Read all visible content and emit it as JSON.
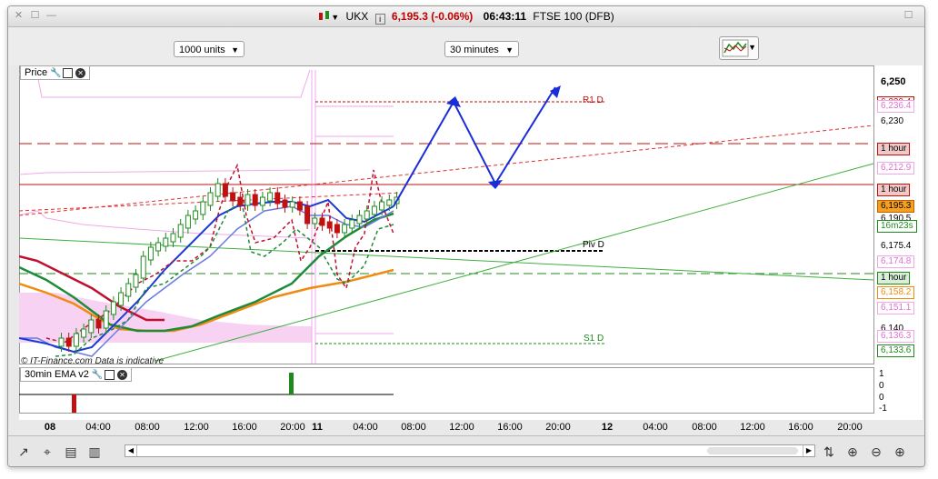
{
  "window": {
    "symbol": "UKX",
    "price": "6,195.3 (-0.06%)",
    "time": "06:43:11",
    "instrument": "FTSE 100 (DFB)"
  },
  "toolbar": {
    "units": "1000 units",
    "interval": "30 minutes"
  },
  "panels": {
    "price": "Price",
    "ema": "30min EMA v2"
  },
  "watermark": "© IT-Finance.com  Data is indicative",
  "pivots": {
    "r1": "R1 D",
    "piv": "Piv D",
    "s1": "S1 D"
  },
  "axis": {
    "top_label": "6,250",
    "price_labels": [
      {
        "text": "6,239.4",
        "kind": "red"
      },
      {
        "text": "6,236.4",
        "kind": "pink"
      },
      {
        "text": "6,230",
        "kind": "plain"
      },
      {
        "text": "1 hour",
        "kind": "hour"
      },
      {
        "text": "6,212.9",
        "kind": "pink"
      },
      {
        "text": "1 hour",
        "kind": "hour"
      },
      {
        "text": "6,195.3",
        "kind": "current"
      },
      {
        "text": "6,190.5",
        "kind": "plain"
      },
      {
        "text": "16m23s",
        "kind": "green"
      },
      {
        "text": "6,175.4",
        "kind": "plain"
      },
      {
        "text": "6,174.8",
        "kind": "pink"
      },
      {
        "text": "1 hour",
        "kind": "hourgreen"
      },
      {
        "text": "6,158.2",
        "kind": "orange"
      },
      {
        "text": "6,151.1",
        "kind": "pink"
      },
      {
        "text": "6,140",
        "kind": "plain"
      },
      {
        "text": "6,136.3",
        "kind": "pink"
      },
      {
        "text": "6,133.6",
        "kind": "green"
      }
    ],
    "ema_labels": [
      "1",
      "0",
      "0",
      "-1"
    ],
    "x_labels": [
      "08",
      "04:00",
      "08:00",
      "12:00",
      "16:00",
      "20:00",
      "11",
      "04:00",
      "08:00",
      "12:00",
      "16:00",
      "20:00",
      "12",
      "04:00",
      "08:00",
      "12:00",
      "16:00",
      "20:00"
    ]
  },
  "colors": {
    "up": "#1f8a1f",
    "down": "#c01010",
    "arrow": "#1a2ed8",
    "ema_blue": "#1a3ad8",
    "ema_green": "#1f8a3a",
    "ema_orange": "#f08a10",
    "ema_red": "#c01030",
    "bollinger": "#f0a8e8"
  }
}
